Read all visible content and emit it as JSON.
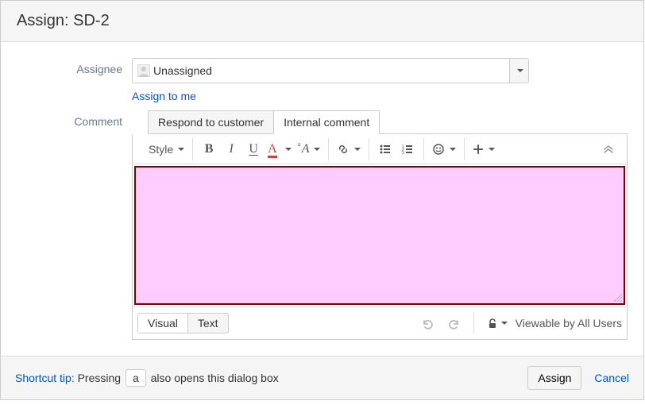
{
  "header": {
    "title": "Assign: SD-2"
  },
  "labels": {
    "assignee": "Assignee",
    "comment": "Comment"
  },
  "assignee": {
    "value": "Unassigned",
    "assign_to_me": "Assign to me"
  },
  "tabs": {
    "respond": "Respond to customer",
    "internal": "Internal comment"
  },
  "toolbar": {
    "style": "Style",
    "bold": "B",
    "italic": "I",
    "underline": "U",
    "text_color": "A",
    "sup_a": "A"
  },
  "modes": {
    "visual": "Visual",
    "text": "Text"
  },
  "security": {
    "label": "Viewable by All Users"
  },
  "footer": {
    "shortcut_label": "Shortcut tip:",
    "shortcut_pre": " Pressing ",
    "shortcut_key": "a",
    "shortcut_post": " also opens this dialog box",
    "assign": "Assign",
    "cancel": "Cancel"
  }
}
